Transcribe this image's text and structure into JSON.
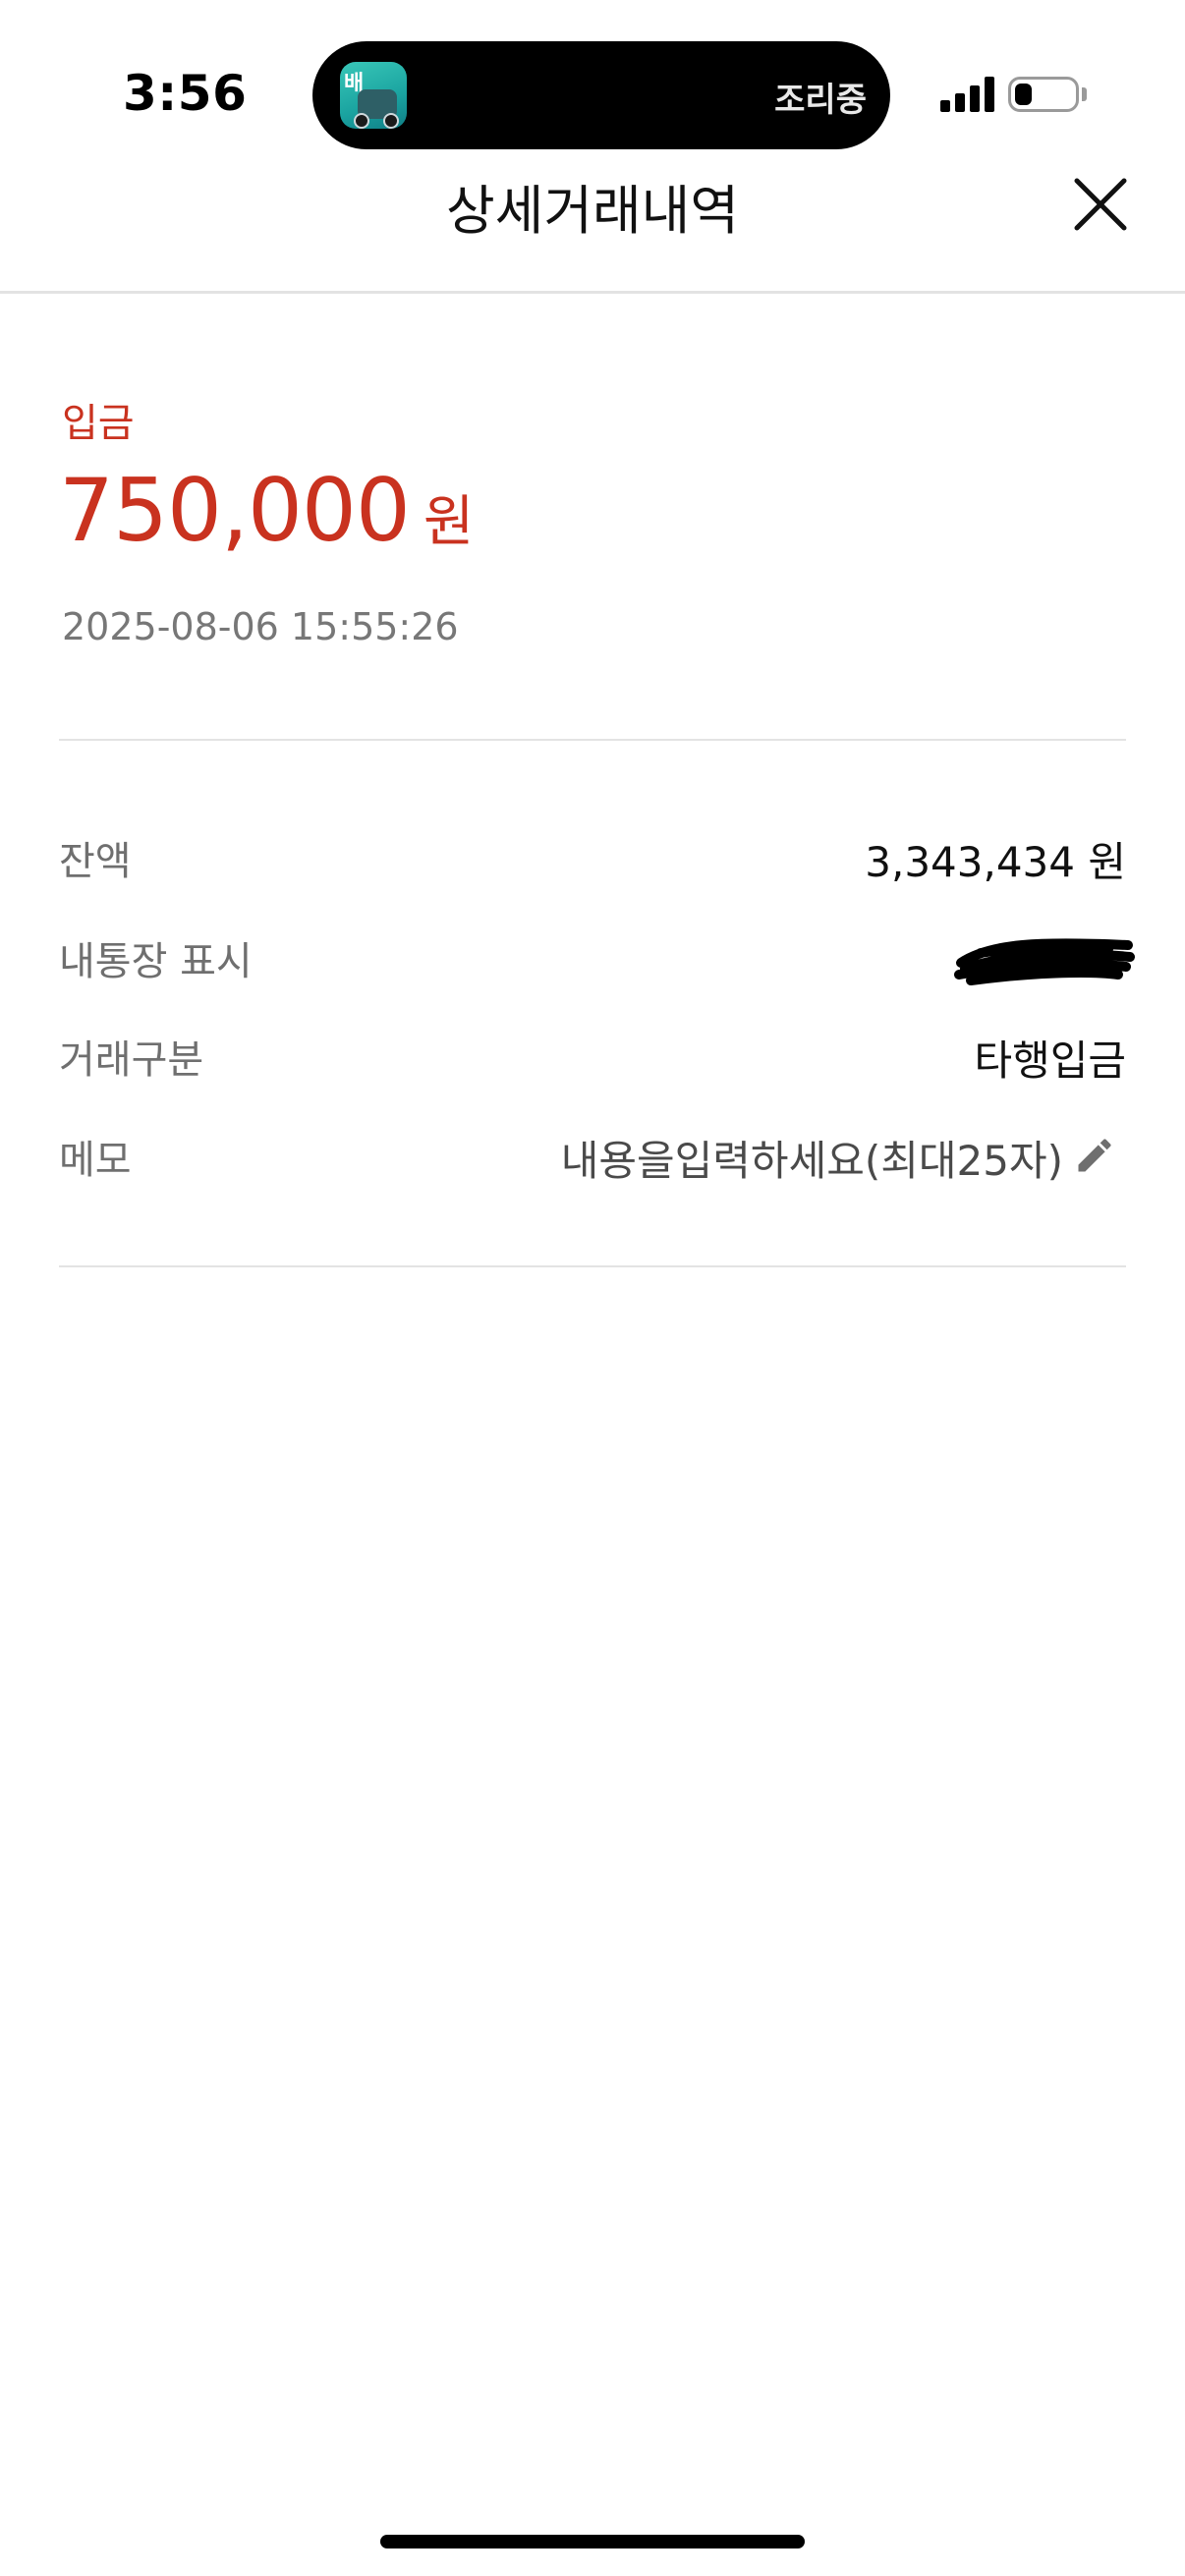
{
  "status_bar": {
    "time": "3:56",
    "live_activity": {
      "app_icon": "delivery-app-icon",
      "app_icon_text": "배",
      "status": "조리중"
    },
    "signal_bars": 4,
    "battery_level": 0.3
  },
  "header": {
    "title": "상세거래내역",
    "close_icon": "close-icon"
  },
  "summary": {
    "type": "입금",
    "amount": "750,000",
    "unit": "원",
    "datetime": "2025-08-06 15:55:26",
    "accent_color": "#c9321f"
  },
  "details": {
    "balance": {
      "label": "잔액",
      "value": "3,343,434 원"
    },
    "passbook_display": {
      "label": "내통장 표시",
      "value_redacted": true
    },
    "transaction_kind": {
      "label": "거래구분",
      "value": "타행입금"
    },
    "memo": {
      "label": "메모",
      "placeholder": "내용을입력하세요(최대25자)",
      "edit_icon": "pencil-icon"
    }
  }
}
